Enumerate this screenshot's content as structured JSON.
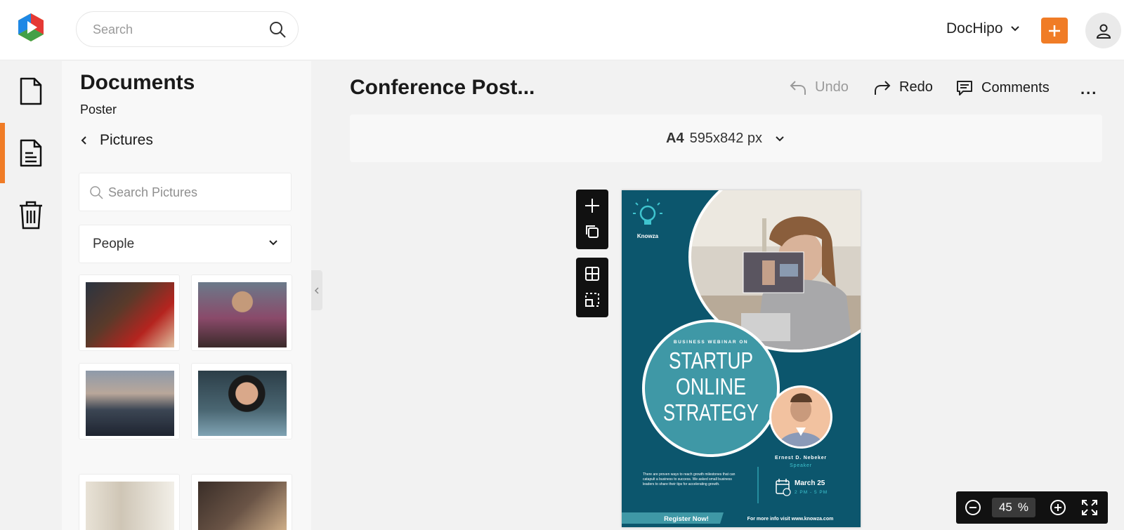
{
  "header": {
    "search_placeholder": "Search",
    "team_name": "DocHipo",
    "colors": {
      "accent": "#f07c26"
    }
  },
  "rail": {
    "items": [
      {
        "icon": "document-icon"
      },
      {
        "icon": "file-text-icon",
        "active": true
      },
      {
        "icon": "trash-icon"
      }
    ]
  },
  "panel": {
    "title": "Documents",
    "subtitle": "Poster",
    "back_label": "Pictures",
    "search_placeholder": "Search Pictures",
    "category": "People",
    "thumbnails": [
      {
        "alt": "couple-laptop"
      },
      {
        "alt": "man-scarf"
      },
      {
        "alt": "city-skyline"
      },
      {
        "alt": "curly-child"
      },
      {
        "alt": "man-office"
      },
      {
        "alt": "woman-desk"
      }
    ]
  },
  "editor": {
    "doc_title": "Conference Post...",
    "undo_label": "Undo",
    "redo_label": "Redo",
    "comments_label": "Comments",
    "more_label": "...",
    "page_size_name": "A4",
    "page_size_dims": "595x842 px",
    "zoom_value": "45",
    "zoom_unit": "%"
  },
  "poster": {
    "brand": "Knowza",
    "kicker": "BUSINESS WEBINAR ON",
    "headline_1": "STARTUP",
    "headline_2": "ONLINE",
    "headline_3": "STRATEGY",
    "speaker_name": "Ernest D. Nebeker",
    "speaker_role": "Speaker",
    "body": "There are proven ways to reach growth milestones that can catapult a business to success. We asked small business leaders to share their tips for accelerating growth.",
    "date": "March 25",
    "time": "2 PM - 5 PM",
    "cta": "Register Now!",
    "info": "For more info visit www.knowza.com",
    "colors": {
      "navy": "#0c566d",
      "teal": "#3f98a6",
      "cyan": "#3fc4cf"
    }
  }
}
